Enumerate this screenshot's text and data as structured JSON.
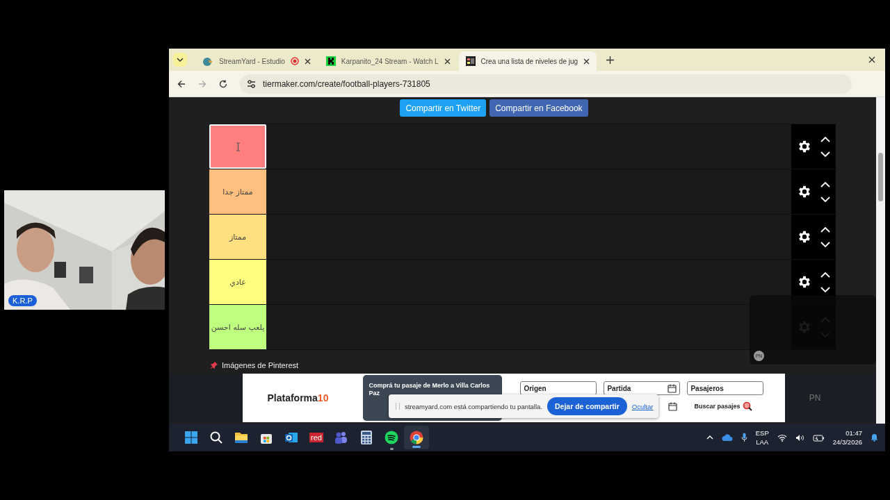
{
  "camera": {
    "badge": "K.R.P"
  },
  "browser": {
    "tabs": [
      {
        "title": "StreamYard - Estudio",
        "selected": false,
        "recording": true,
        "kind": "streamyard"
      },
      {
        "title": "Karpanito_24 Stream - Watch L",
        "selected": false,
        "recording": false,
        "kind": "kick"
      },
      {
        "title": "Crea una lista de niveles de jug",
        "selected": true,
        "recording": false,
        "kind": "tiermaker"
      }
    ],
    "url": "tiermaker.com/create/football-players-731805"
  },
  "page": {
    "share_buttons": [
      {
        "label": "Compartir en Twitter",
        "kind": "twitter"
      },
      {
        "label": "Compartir en Facebook",
        "kind": "facebook"
      }
    ],
    "tiers": [
      {
        "color": "#ff7f7f",
        "selected": true
      },
      {
        "label": "ممتاز جدا",
        "color": "#ffbf7f",
        "selected": false
      },
      {
        "label": "ممتاز",
        "color": "#ffdf7f",
        "selected": false
      },
      {
        "label": "عادي",
        "color": "#ffff7f",
        "selected": false
      },
      {
        "label": "يلعب سله احسن",
        "color": "#bfff7f",
        "selected": false
      }
    ],
    "pinterest": "Imágenes de Pinterest",
    "ad": {
      "brand": "Plataforma",
      "brand_number": "10",
      "headline": "Comprá tu pasaje de Merlo a Villa Carlos Paz",
      "fields": [
        "Origen",
        "Partida",
        "Pasajeros"
      ],
      "search": "Buscar pasajes",
      "side_text": "PN"
    },
    "popup": {
      "avatar": "PN"
    }
  },
  "share_bar": {
    "message": "streamyard.com está compartiendo tu pantalla.",
    "stop": "Dejar de compartir",
    "hide": "Ocultar"
  },
  "taskbar": {
    "apps": [
      {
        "kind": "start",
        "open": false
      },
      {
        "kind": "search",
        "open": false
      },
      {
        "kind": "folder",
        "open": false
      },
      {
        "kind": "store",
        "open": false
      },
      {
        "kind": "mail",
        "open": false
      },
      {
        "kind": "text",
        "label": "red",
        "open": false
      },
      {
        "kind": "people",
        "open": false
      },
      {
        "kind": "calculator",
        "open": false
      },
      {
        "kind": "spotify",
        "open": true
      },
      {
        "kind": "chrome",
        "open": true
      }
    ],
    "lang": "ESP",
    "layout": "LAA",
    "time": "01:47",
    "date": "24/3/2026"
  }
}
